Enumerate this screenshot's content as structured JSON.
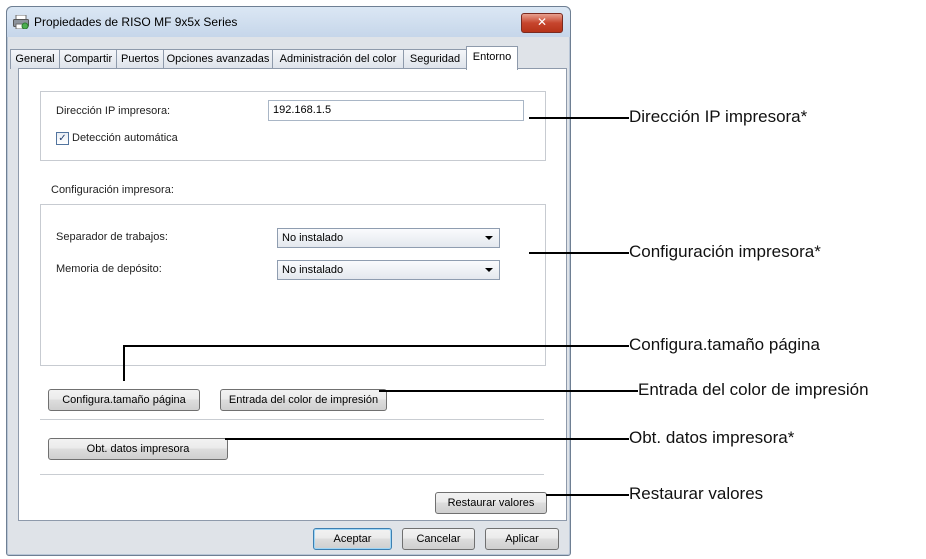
{
  "window": {
    "title": "Propiedades de RISO MF 9x5x Series",
    "close_glyph": "✕"
  },
  "tabs": [
    {
      "label": "General"
    },
    {
      "label": "Compartir"
    },
    {
      "label": "Puertos"
    },
    {
      "label": "Opciones avanzadas"
    },
    {
      "label": "Administración del color"
    },
    {
      "label": "Seguridad"
    },
    {
      "label": "Entorno"
    }
  ],
  "active_tab": "Entorno",
  "ip_section": {
    "label": "Dirección IP impresora:",
    "value": "192.168.1.5",
    "auto_detect_label": "Detección automática",
    "auto_detect_checked": true,
    "check_glyph": "✓"
  },
  "printer_config": {
    "heading": "Configuración impresora:",
    "job_separator_label": "Separador de trabajos:",
    "job_separator_value": "No instalado",
    "storage_memory_label": "Memoria de depósito:",
    "storage_memory_value": "No instalado"
  },
  "buttons": {
    "page_size": "Configura.tamaño página",
    "color_entry": "Entrada del color de impresión",
    "get_printer_data": "Obt. datos impresora",
    "restore_defaults": "Restaurar valores",
    "ok": "Aceptar",
    "cancel": "Cancelar",
    "apply": "Aplicar"
  },
  "callouts": {
    "ip": "Dirección IP impresora*",
    "config": "Configuración impresora*",
    "page_size": "Configura.tamaño página",
    "color_entry": "Entrada del color de impresión",
    "get_data": "Obt. datos impresora*",
    "restore": "Restaurar valores"
  }
}
